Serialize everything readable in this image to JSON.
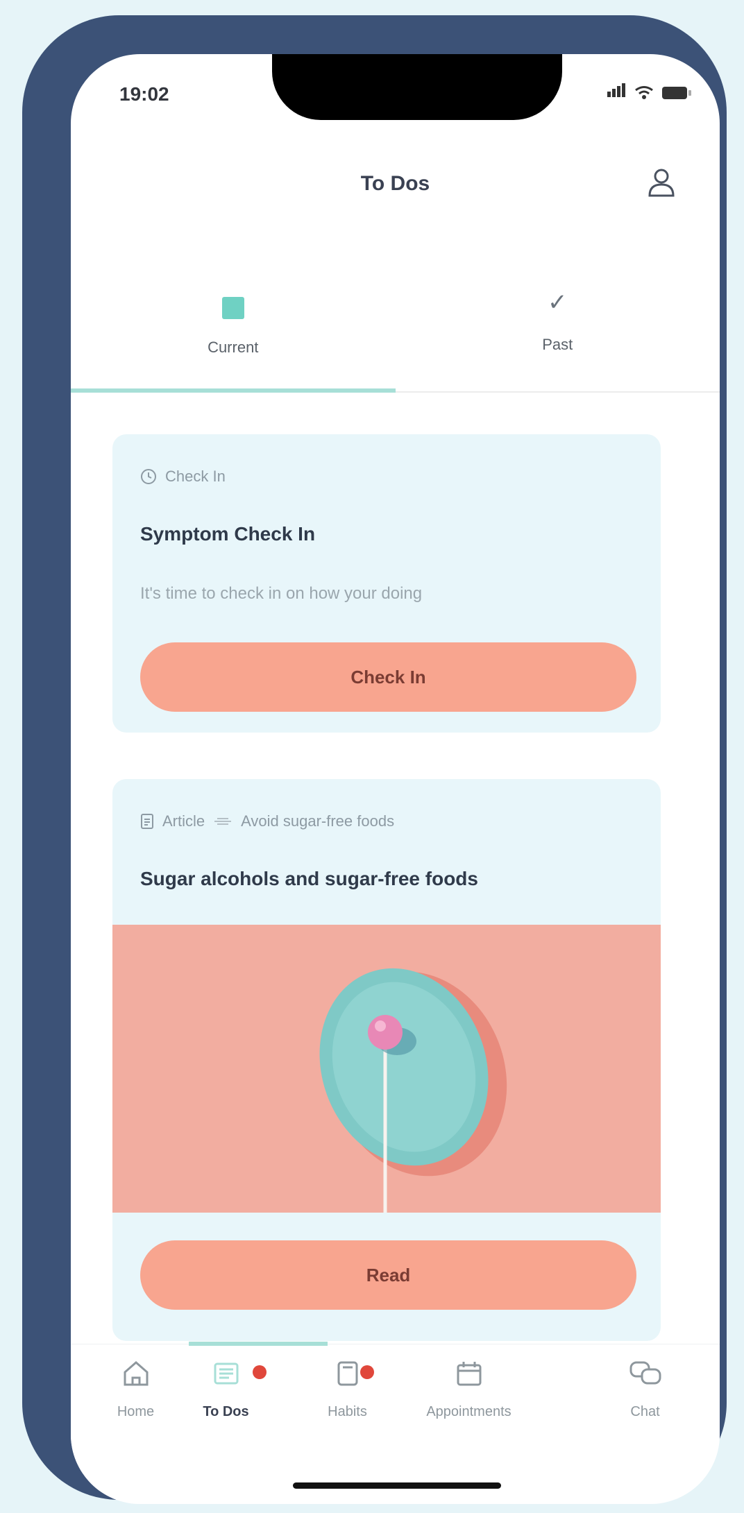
{
  "status": {
    "time": "19:02"
  },
  "header": {
    "title": "To Dos"
  },
  "tabs": [
    {
      "label": "Current",
      "icon": "todo-square-icon",
      "active": true
    },
    {
      "label": "Past",
      "icon": "check-icon",
      "active": false
    }
  ],
  "cards": [
    {
      "type_label": "Check In",
      "title": "Symptom Check In",
      "description": "It's time to check in on how your doing",
      "button": "Check In"
    },
    {
      "type_label": "Article",
      "tag": "Avoid sugar-free foods",
      "title": "Sugar alcohols and sugar-free foods",
      "button": "Read"
    }
  ],
  "bottom_nav": [
    {
      "label": "Home",
      "icon": "home-icon",
      "badge": false,
      "active": false
    },
    {
      "label": "To Dos",
      "icon": "todo-list-icon",
      "badge": true,
      "active": true
    },
    {
      "label": "Habits",
      "icon": "habit-icon",
      "badge": true,
      "active": false
    },
    {
      "label": "Appointments",
      "icon": "calendar-icon",
      "badge": false,
      "active": false
    },
    {
      "label": "Chat",
      "icon": "chat-icon",
      "badge": false,
      "active": false
    }
  ],
  "colors": {
    "accent": "#a7dfd7",
    "button": "#f8a58f",
    "frame": "#3c5277",
    "card": "#e8f6fa"
  }
}
